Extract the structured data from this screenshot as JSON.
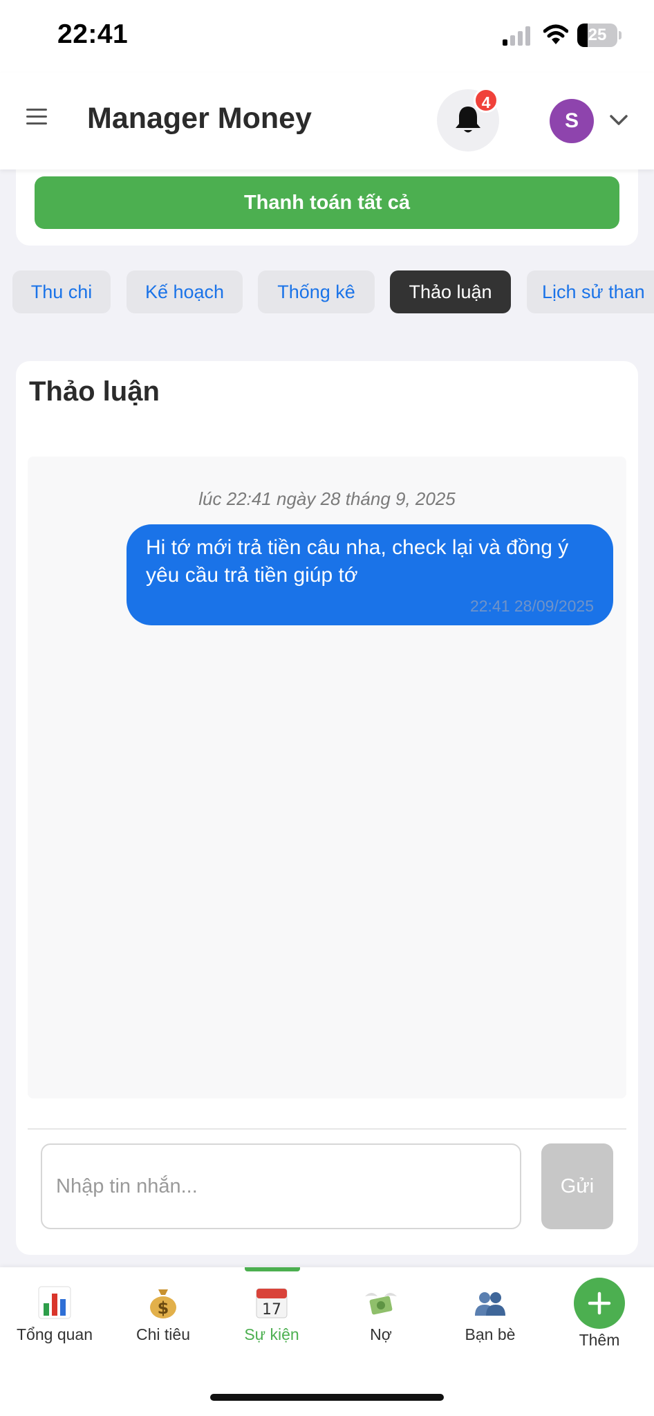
{
  "status_bar": {
    "time": "22:41",
    "battery_level": "25",
    "icons": [
      "signal-icon",
      "wifi-icon",
      "battery-icon"
    ]
  },
  "header": {
    "title": "Manager Money",
    "notification_count": "4",
    "avatar_initial": "S",
    "avatar_color": "#8e44ad",
    "icons": [
      "menu-icon",
      "bell-icon",
      "chevron-down-icon"
    ]
  },
  "pay_all": {
    "label": "Thanh toán tất cả",
    "color": "#4caf50"
  },
  "tabs": [
    {
      "label": "Thu chi",
      "active": false
    },
    {
      "label": "Kế hoạch",
      "active": false
    },
    {
      "label": "Thống kê",
      "active": false
    },
    {
      "label": "Thảo luận",
      "active": true
    },
    {
      "label": "Lịch sử than",
      "active": false
    }
  ],
  "discussion": {
    "title": "Thảo luận",
    "timestamp_label": "lúc 22:41 ngày 28 tháng 9, 2025",
    "messages": [
      {
        "text": "Hi tớ mới trả tiền câu nha, check lại và đồng ý yêu cầu trả tiền giúp tớ",
        "meta": "22:41 28/09/2025",
        "bubble_color": "#1a73e8"
      }
    ],
    "input_placeholder": "Nhập tin nhắn...",
    "send_label": "Gửi"
  },
  "bottom_nav": {
    "items": [
      {
        "label": "Tổng quan",
        "icon": "chart-icon",
        "active": false
      },
      {
        "label": "Chi tiêu",
        "icon": "money-bag-icon",
        "active": false
      },
      {
        "label": "Sự kiện",
        "icon": "calendar-icon",
        "active": true
      },
      {
        "label": "Nợ",
        "icon": "money-wings-icon",
        "active": false
      },
      {
        "label": "Bạn bè",
        "icon": "friends-icon",
        "active": false
      }
    ],
    "add_label": "Thêm",
    "add_icon": "plus-icon",
    "accent": "#4caf50"
  }
}
